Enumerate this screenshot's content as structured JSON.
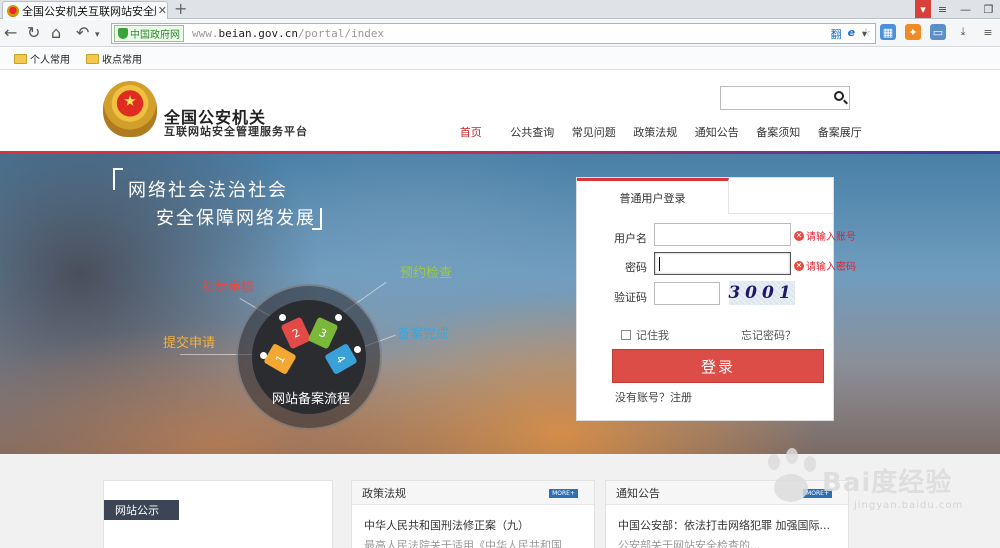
{
  "browser": {
    "tab_title": "全国公安机关互联网站安全服务",
    "tab_close": "✕",
    "new_tab": "+",
    "gov_badge": "中国政府网",
    "url_prefix": "www.",
    "url_domain": "beian.gov.cn",
    "url_path": "/portal/index",
    "bookmarks": [
      "个人常用",
      "收点常用"
    ]
  },
  "site": {
    "name_line1": "全国公安机关",
    "name_line2": "互联网站安全管理服务平台",
    "search_placeholder": "",
    "nav": [
      "首页",
      "公共查询",
      "常见问题",
      "政策法规",
      "通知公告",
      "备案须知",
      "备案展厅"
    ],
    "nav_active": "首页"
  },
  "banner": {
    "slogan1": "网络社会法治社会",
    "slogan2": "安全保障网络发展",
    "flow_title": "网站备案流程",
    "steps": [
      {
        "num": "1",
        "label": "提交申请"
      },
      {
        "num": "2",
        "label": "初步审核"
      },
      {
        "num": "3",
        "label": "预约检查"
      },
      {
        "num": "4",
        "label": "备案完成"
      }
    ]
  },
  "login": {
    "tab": "普通用户登录",
    "username_label": "用户名",
    "password_label": "密码",
    "captcha_label": "验证码",
    "username_error": "请输入账号",
    "password_error": "请输入密码",
    "captcha_text": "3001",
    "remember": "记住我",
    "forgot": "忘记密码？",
    "submit": "登录",
    "register": "没有账号？注册"
  },
  "content": {
    "notice_title": "网站公示",
    "policy": {
      "title": "政策法规",
      "more": "MORE+",
      "item1": "中华人民共和国刑法修正案（九）",
      "item2": "最高人民法院关于适用《中华人民共和国"
    },
    "announce": {
      "title": "通知公告",
      "more": "MORE+",
      "item1": "中国公安部：依法打击网络犯罪 加强国际...",
      "item2": "公安部关于网站安全检查的..."
    }
  },
  "watermark": {
    "text": "Bai度经验",
    "sub": "jingyan.baidu.com"
  }
}
